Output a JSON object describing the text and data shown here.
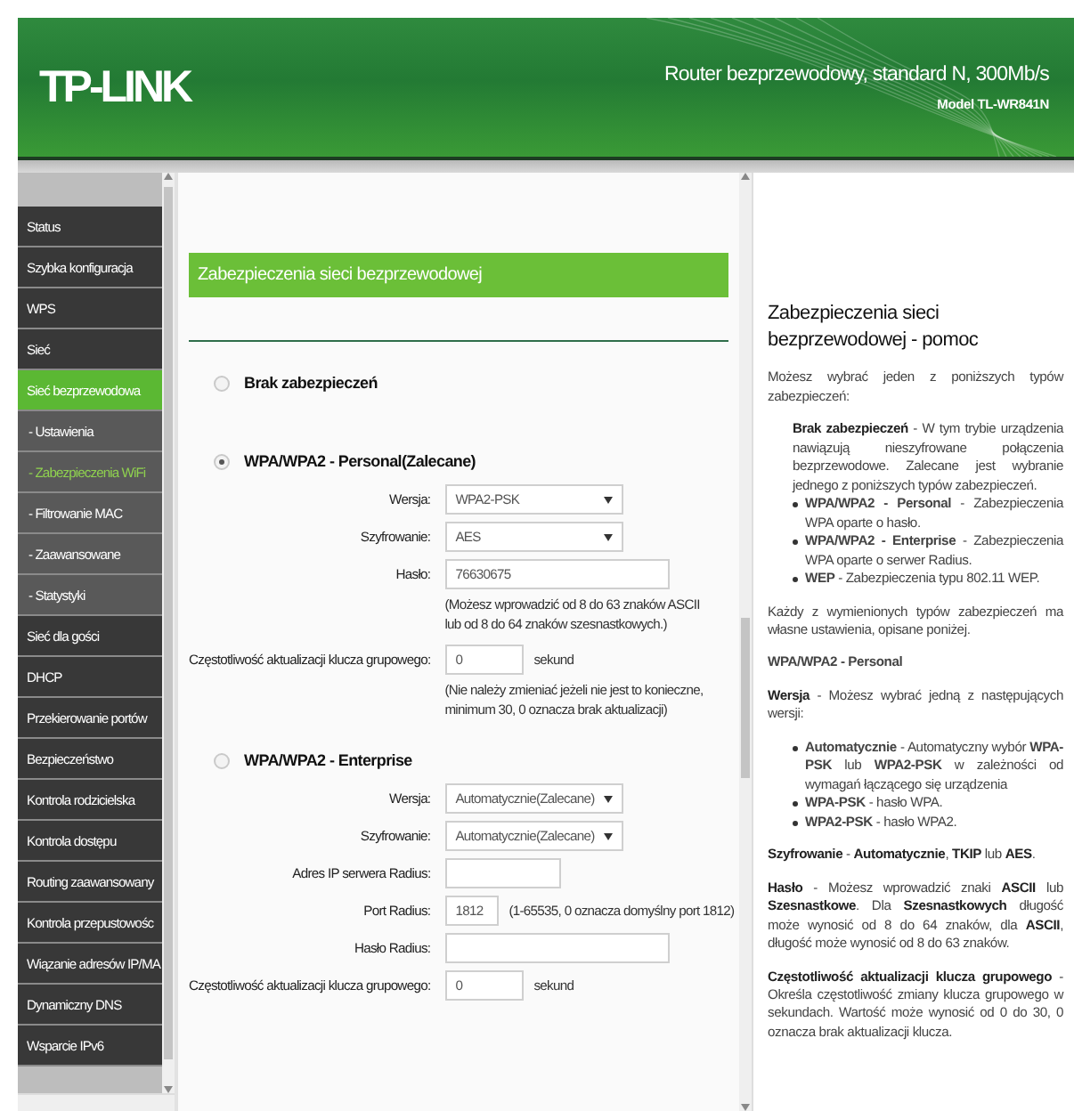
{
  "header": {
    "logo": "TP-LINK",
    "product": "Router bezprzewodowy, standard N, 300Mb/s",
    "model": "Model TL-WR841N"
  },
  "sidebar": {
    "items": [
      {
        "label": "Status",
        "selected": false
      },
      {
        "label": "Szybka konfiguracja",
        "selected": false
      },
      {
        "label": "WPS",
        "selected": false
      },
      {
        "label": "Sieć",
        "selected": false
      },
      {
        "label": "Sieć bezprzewodowa",
        "selected": true,
        "children": [
          {
            "label": "- Ustawienia",
            "selected": false
          },
          {
            "label": "- Zabezpieczenia WiFi",
            "selected": true
          },
          {
            "label": "- Filtrowanie MAC",
            "selected": false
          },
          {
            "label": "- Zaawansowane",
            "selected": false
          },
          {
            "label": "- Statystyki",
            "selected": false
          }
        ]
      },
      {
        "label": "Sieć dla gości",
        "selected": false
      },
      {
        "label": "DHCP",
        "selected": false
      },
      {
        "label": "Przekierowanie portów",
        "selected": false
      },
      {
        "label": "Bezpieczeństwo",
        "selected": false
      },
      {
        "label": "Kontrola rodzicielska",
        "selected": false
      },
      {
        "label": "Kontrola dostępu",
        "selected": false
      },
      {
        "label": "Routing zaawansowany",
        "selected": false
      },
      {
        "label": "Kontrola przepustowośc",
        "selected": false
      },
      {
        "label": "Wiązanie adresów IP/MA",
        "selected": false
      },
      {
        "label": "Dynamiczny DNS",
        "selected": false
      },
      {
        "label": "Wsparcie IPv6",
        "selected": false
      }
    ]
  },
  "main": {
    "title": "Zabezpieczenia sieci bezprzewodowej",
    "options": [
      {
        "label": "Brak zabezpieczeń",
        "selected": false
      },
      {
        "label": "WPA/WPA2 - Personal(Zalecane)",
        "selected": true,
        "fields": [
          {
            "kind": "select",
            "label": "Wersja:",
            "value": "WPA2-PSK"
          },
          {
            "kind": "select",
            "label": "Szyfrowanie:",
            "value": "AES"
          },
          {
            "kind": "long",
            "label": "Hasło:",
            "value": "76630675",
            "note": "(Możesz wprowadzić od 8 do 63 znaków ASCII lub od 8 do 64 znaków szesnastkowych.)"
          },
          {
            "kind": "short",
            "label": "Częstotliwość aktualizacji klucza grupowego:",
            "value": "0",
            "suffix": "sekund",
            "note": "(Nie należy zmieniać jeżeli nie jest to konieczne, minimum 30, 0 oznacza brak aktualizacji)"
          }
        ]
      },
      {
        "label": "WPA/WPA2 - Enterprise",
        "selected": false,
        "fields": [
          {
            "kind": "select",
            "label": "Wersja:",
            "value": "Automatycznie(Zalecane)"
          },
          {
            "kind": "select",
            "label": "Szyfrowanie:",
            "value": "Automatycznie(Zalecane)"
          },
          {
            "kind": "medium",
            "label": "Adres IP serwera Radius:"
          },
          {
            "kind": "tiny",
            "label": "Port Radius:",
            "value": "1812",
            "suffix": "(1-65535, 0 oznacza domyślny port 1812)"
          },
          {
            "kind": "long",
            "label": "Hasło Radius:"
          },
          {
            "kind": "short",
            "label": "Częstotliwość aktualizacji klucza grupowego:",
            "value": "0",
            "suffix": "sekund"
          }
        ]
      }
    ]
  },
  "help": {
    "title": "Zabezpieczenia sieci bezprzewodowej - pomoc",
    "blocks": [
      {
        "kind": "para",
        "text": "Możesz wybrać jeden z poniższych typów zabezpieczeń:"
      },
      {
        "kind": "indent",
        "text": "**Brak zabezpieczeń** - W tym trybie urządzenia nawiązują nieszyfrowane połączenia bezprzewodowe. Zalecane jest wybranie jednego z poniższych typów zabezpieczeń."
      },
      {
        "kind": "list",
        "items": [
          "**WPA/WPA2 - Personal** - Zabezpieczenia WPA oparte o hasło.",
          "**WPA/WPA2 - Enterprise** - Zabezpieczenia WPA oparte o serwer Radius.",
          "**WEP** - Zabezpieczenia typu 802.11 WEP."
        ]
      },
      {
        "kind": "para",
        "text": "Każdy z wymienionych typów zabezpieczeń ma własne ustawienia, opisane poniżej."
      },
      {
        "kind": "heading",
        "text": "WPA/WPA2 - Personal"
      },
      {
        "kind": "para",
        "text": "**Wersja** - Możesz wybrać jedną z następujących wersji:"
      },
      {
        "kind": "list",
        "items": [
          "**Automatycznie** - Automatyczny wybór **WPA-PSK** lub **WPA2-PSK** w zależności od wymagań łączącego się urządzenia",
          "**WPA-PSK** - hasło WPA.",
          "**WPA2-PSK** - hasło WPA2."
        ]
      },
      {
        "kind": "para",
        "text": "**Szyfrowanie** - **Automatycznie**, **TKIP** lub **AES**."
      },
      {
        "kind": "para",
        "text": "**Hasło** - Możesz wprowadzić znaki **ASCII** lub **Szesnastkowe**. Dla **Szesnastkowych** długość może wynosić od 8 do 64 znaków, dla **ASCII**, długość może wynosić od 8 do 63 znaków."
      },
      {
        "kind": "para",
        "text": "**Częstotliwość aktualizacji klucza grupowego** - Określa częstotliwość zmiany klucza grupowego w sekundach. Wartość może wynosić od 0 do 30, 0 oznacza brak aktualizacji klucza."
      }
    ]
  }
}
